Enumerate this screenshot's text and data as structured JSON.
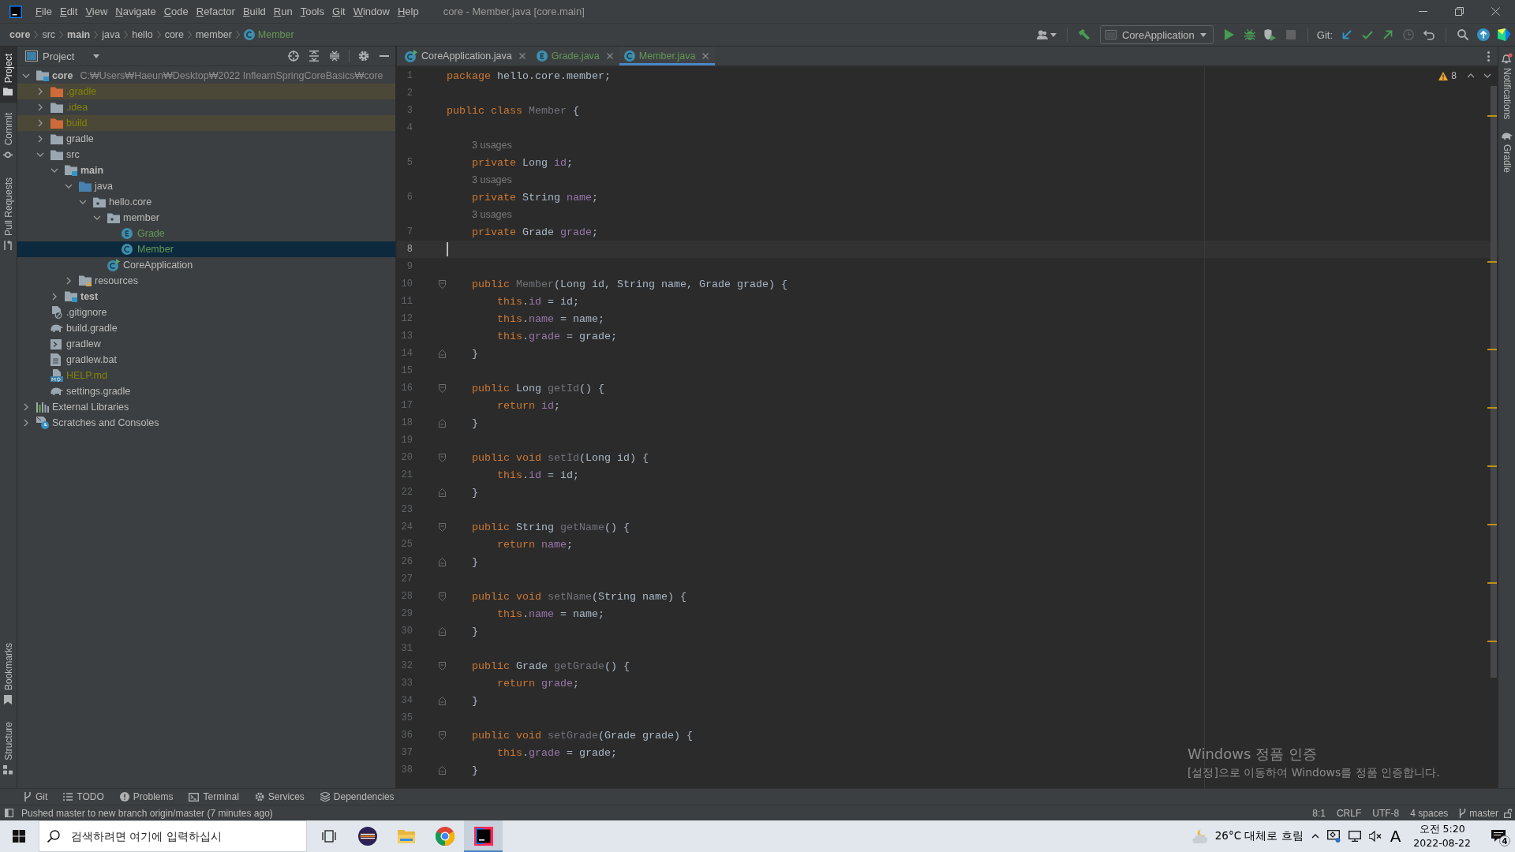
{
  "window": {
    "title": "core - Member.java [core.main]",
    "menu": [
      "File",
      "Edit",
      "View",
      "Navigate",
      "Code",
      "Refactor",
      "Build",
      "Run",
      "Tools",
      "Git",
      "Window",
      "Help"
    ]
  },
  "navigation_bar": {
    "breadcrumbs": [
      {
        "label": "core",
        "kind": "module",
        "added": false
      },
      {
        "label": "src",
        "kind": "folder",
        "added": false
      },
      {
        "label": "main",
        "kind": "sourceroot",
        "added": false
      },
      {
        "label": "java",
        "kind": "folder",
        "added": false
      },
      {
        "label": "hello",
        "kind": "folder",
        "added": false
      },
      {
        "label": "core",
        "kind": "folder",
        "added": false
      },
      {
        "label": "member",
        "kind": "folder",
        "added": false
      },
      {
        "label": "Member",
        "kind": "class",
        "added": true
      }
    ],
    "run_configuration": "CoreApplication",
    "git_label": "Git:"
  },
  "left_strip": {
    "top": [
      {
        "label": "Project",
        "kind": "project",
        "selected": true
      },
      {
        "label": "Commit",
        "kind": "commit",
        "selected": false
      },
      {
        "label": "Pull Requests",
        "kind": "pullrequests",
        "selected": false
      }
    ],
    "bottom": [
      {
        "label": "Bookmarks",
        "kind": "bookmarks",
        "selected": false
      },
      {
        "label": "Structure",
        "kind": "structure",
        "selected": false
      }
    ]
  },
  "project_panel": {
    "title": "Project",
    "tree": [
      {
        "label": "core",
        "path": "C:₩Users₩Haeun₩Desktop₩2022 InflearnSpringCoreBasics₩core",
        "kind": "module",
        "added": false,
        "ignored": false,
        "selected": false,
        "expanded": true,
        "children": [
          {
            "label": ".gradle",
            "kind": "excluded",
            "added": false,
            "ignored": true,
            "selected": false,
            "expanded": false
          },
          {
            "label": ".idea",
            "kind": "folder",
            "added": false,
            "ignored": true,
            "selected": false,
            "expanded": false
          },
          {
            "label": "build",
            "kind": "excluded",
            "added": false,
            "ignored": true,
            "selected": false,
            "expanded": false
          },
          {
            "label": "gradle",
            "kind": "folder",
            "added": false,
            "ignored": false,
            "selected": false,
            "expanded": false
          },
          {
            "label": "src",
            "kind": "folder",
            "added": false,
            "ignored": false,
            "selected": false,
            "expanded": true,
            "children": [
              {
                "label": "main",
                "kind": "sourceroot",
                "added": false,
                "ignored": false,
                "selected": false,
                "expanded": true,
                "children": [
                  {
                    "label": "java",
                    "kind": "javaroot",
                    "added": false,
                    "ignored": false,
                    "selected": false,
                    "expanded": true,
                    "children": [
                      {
                        "label": "hello.core",
                        "kind": "package",
                        "added": false,
                        "ignored": false,
                        "selected": false,
                        "expanded": true,
                        "children": [
                          {
                            "label": "member",
                            "kind": "package",
                            "added": false,
                            "ignored": false,
                            "selected": false,
                            "expanded": true,
                            "children": [
                              {
                                "label": "Grade",
                                "kind": "enum",
                                "added": true,
                                "ignored": false,
                                "selected": false
                              },
                              {
                                "label": "Member",
                                "kind": "class",
                                "added": true,
                                "ignored": false,
                                "selected": true
                              }
                            ]
                          },
                          {
                            "label": "CoreApplication",
                            "kind": "mainclass",
                            "added": false,
                            "ignored": false,
                            "selected": false
                          }
                        ]
                      }
                    ]
                  },
                  {
                    "label": "resources",
                    "kind": "resources",
                    "added": false,
                    "ignored": false,
                    "selected": false,
                    "expanded": false
                  }
                ]
              },
              {
                "label": "test",
                "kind": "sourceroot",
                "added": false,
                "ignored": false,
                "selected": false,
                "expanded": false
              }
            ]
          },
          {
            "label": ".gitignore",
            "kind": "ignorefile",
            "added": false,
            "ignored": false,
            "selected": false
          },
          {
            "label": "build.gradle",
            "kind": "gradle",
            "added": false,
            "ignored": false,
            "selected": false
          },
          {
            "label": "gradlew",
            "kind": "script",
            "added": false,
            "ignored": false,
            "selected": false
          },
          {
            "label": "gradlew.bat",
            "kind": "batch",
            "added": false,
            "ignored": false,
            "selected": false
          },
          {
            "label": "HELP.md",
            "kind": "markdown",
            "added": false,
            "ignored": true,
            "selected": false
          },
          {
            "label": "settings.gradle",
            "kind": "gradle",
            "added": false,
            "ignored": false,
            "selected": false
          }
        ]
      },
      {
        "label": "External Libraries",
        "kind": "libraries",
        "added": false,
        "ignored": false,
        "selected": false,
        "expanded": false
      },
      {
        "label": "Scratches and Consoles",
        "kind": "scratches",
        "added": false,
        "ignored": false,
        "selected": false,
        "expanded": false
      }
    ]
  },
  "editor": {
    "tabs": [
      {
        "label": "CoreApplication.java",
        "kind": "mainclass",
        "added": false,
        "selected": false
      },
      {
        "label": "Grade.java",
        "kind": "enum",
        "added": true,
        "selected": false
      },
      {
        "label": "Member.java",
        "kind": "class",
        "added": true,
        "selected": true
      }
    ],
    "warnings": "8",
    "lines": [
      {
        "kind": "code",
        "number": "1",
        "current": false,
        "tokens": [
          {
            "kind": "keyword",
            "text": "package "
          },
          {
            "kind": "plain",
            "text": "hello.core.member;"
          }
        ]
      },
      {
        "kind": "code",
        "number": "2",
        "current": false
      },
      {
        "kind": "code",
        "number": "3",
        "current": false,
        "tokens": [
          {
            "kind": "keyword",
            "text": "public class "
          },
          {
            "kind": "unused",
            "text": "Member"
          },
          {
            "kind": "plain",
            "text": " {"
          }
        ]
      },
      {
        "kind": "code",
        "number": "4",
        "current": false
      },
      {
        "kind": "inlay",
        "text": "3 usages"
      },
      {
        "kind": "code",
        "number": "5",
        "current": false,
        "tokens": [
          {
            "kind": "keyword",
            "text": "    private "
          },
          {
            "kind": "plain",
            "text": "Long "
          },
          {
            "kind": "field",
            "text": "id"
          },
          {
            "kind": "plain",
            "text": ";"
          }
        ]
      },
      {
        "kind": "inlay",
        "text": "3 usages"
      },
      {
        "kind": "code",
        "number": "6",
        "current": false,
        "tokens": [
          {
            "kind": "keyword",
            "text": "    private "
          },
          {
            "kind": "plain",
            "text": "String "
          },
          {
            "kind": "field",
            "text": "name"
          },
          {
            "kind": "plain",
            "text": ";"
          }
        ]
      },
      {
        "kind": "inlay",
        "text": "3 usages"
      },
      {
        "kind": "code",
        "number": "7",
        "current": false,
        "tokens": [
          {
            "kind": "keyword",
            "text": "    private "
          },
          {
            "kind": "plain",
            "text": "Grade "
          },
          {
            "kind": "field",
            "text": "grade"
          },
          {
            "kind": "plain",
            "text": ";"
          }
        ]
      },
      {
        "kind": "code",
        "number": "8",
        "current": true
      },
      {
        "kind": "code",
        "number": "9",
        "current": false
      },
      {
        "kind": "opener",
        "number": "10",
        "current": false,
        "tokens": [
          {
            "kind": "keyword",
            "text": "    public "
          },
          {
            "kind": "unused",
            "text": "Member"
          },
          {
            "kind": "plain",
            "text": "(Long id, String name, Grade grade) {"
          }
        ]
      },
      {
        "kind": "code",
        "number": "11",
        "current": false,
        "tokens": [
          {
            "kind": "keyword",
            "text": "        this"
          },
          {
            "kind": "plain",
            "text": "."
          },
          {
            "kind": "field",
            "text": "id"
          },
          {
            "kind": "plain",
            "text": " = id;"
          }
        ]
      },
      {
        "kind": "code",
        "number": "12",
        "current": false,
        "tokens": [
          {
            "kind": "keyword",
            "text": "        this"
          },
          {
            "kind": "plain",
            "text": "."
          },
          {
            "kind": "field",
            "text": "name"
          },
          {
            "kind": "plain",
            "text": " = name;"
          }
        ]
      },
      {
        "kind": "code",
        "number": "13",
        "current": false,
        "tokens": [
          {
            "kind": "keyword",
            "text": "        this"
          },
          {
            "kind": "plain",
            "text": "."
          },
          {
            "kind": "field",
            "text": "grade"
          },
          {
            "kind": "plain",
            "text": " = grade;"
          }
        ]
      },
      {
        "kind": "closer",
        "number": "14",
        "current": false,
        "tokens": [
          {
            "kind": "plain",
            "text": "    }"
          }
        ]
      },
      {
        "kind": "code",
        "number": "15",
        "current": false
      },
      {
        "kind": "opener",
        "number": "16",
        "current": false,
        "tokens": [
          {
            "kind": "keyword",
            "text": "    public "
          },
          {
            "kind": "plain",
            "text": "Long "
          },
          {
            "kind": "unused",
            "text": "getId"
          },
          {
            "kind": "plain",
            "text": "() {"
          }
        ]
      },
      {
        "kind": "code",
        "number": "17",
        "current": false,
        "tokens": [
          {
            "kind": "keyword",
            "text": "        return "
          },
          {
            "kind": "field",
            "text": "id"
          },
          {
            "kind": "plain",
            "text": ";"
          }
        ]
      },
      {
        "kind": "closer",
        "number": "18",
        "current": false,
        "tokens": [
          {
            "kind": "plain",
            "text": "    }"
          }
        ]
      },
      {
        "kind": "code",
        "number": "19",
        "current": false
      },
      {
        "kind": "opener",
        "number": "20",
        "current": false,
        "tokens": [
          {
            "kind": "keyword",
            "text": "    public void "
          },
          {
            "kind": "unused",
            "text": "setId"
          },
          {
            "kind": "plain",
            "text": "(Long id) {"
          }
        ]
      },
      {
        "kind": "code",
        "number": "21",
        "current": false,
        "tokens": [
          {
            "kind": "keyword",
            "text": "        this"
          },
          {
            "kind": "plain",
            "text": "."
          },
          {
            "kind": "field",
            "text": "id"
          },
          {
            "kind": "plain",
            "text": " = id;"
          }
        ]
      },
      {
        "kind": "closer",
        "number": "22",
        "current": false,
        "tokens": [
          {
            "kind": "plain",
            "text": "    }"
          }
        ]
      },
      {
        "kind": "code",
        "number": "23",
        "current": false
      },
      {
        "kind": "opener",
        "number": "24",
        "current": false,
        "tokens": [
          {
            "kind": "keyword",
            "text": "    public "
          },
          {
            "kind": "plain",
            "text": "String "
          },
          {
            "kind": "unused",
            "text": "getName"
          },
          {
            "kind": "plain",
            "text": "() {"
          }
        ]
      },
      {
        "kind": "code",
        "number": "25",
        "current": false,
        "tokens": [
          {
            "kind": "keyword",
            "text": "        return "
          },
          {
            "kind": "field",
            "text": "name"
          },
          {
            "kind": "plain",
            "text": ";"
          }
        ]
      },
      {
        "kind": "closer",
        "number": "26",
        "current": false,
        "tokens": [
          {
            "kind": "plain",
            "text": "    }"
          }
        ]
      },
      {
        "kind": "code",
        "number": "27",
        "current": false
      },
      {
        "kind": "opener",
        "number": "28",
        "current": false,
        "tokens": [
          {
            "kind": "keyword",
            "text": "    public void "
          },
          {
            "kind": "unused",
            "text": "setName"
          },
          {
            "kind": "plain",
            "text": "(String name) {"
          }
        ]
      },
      {
        "kind": "code",
        "number": "29",
        "current": false,
        "tokens": [
          {
            "kind": "keyword",
            "text": "        this"
          },
          {
            "kind": "plain",
            "text": "."
          },
          {
            "kind": "field",
            "text": "name"
          },
          {
            "kind": "plain",
            "text": " = name;"
          }
        ]
      },
      {
        "kind": "closer",
        "number": "30",
        "current": false,
        "tokens": [
          {
            "kind": "plain",
            "text": "    }"
          }
        ]
      },
      {
        "kind": "code",
        "number": "31",
        "current": false
      },
      {
        "kind": "opener",
        "number": "32",
        "current": false,
        "tokens": [
          {
            "kind": "keyword",
            "text": "    public "
          },
          {
            "kind": "plain",
            "text": "Grade "
          },
          {
            "kind": "unused",
            "text": "getGrade"
          },
          {
            "kind": "plain",
            "text": "() {"
          }
        ]
      },
      {
        "kind": "code",
        "number": "33",
        "current": false,
        "tokens": [
          {
            "kind": "keyword",
            "text": "        return "
          },
          {
            "kind": "field",
            "text": "grade"
          },
          {
            "kind": "plain",
            "text": ";"
          }
        ]
      },
      {
        "kind": "closer",
        "number": "34",
        "current": false,
        "tokens": [
          {
            "kind": "plain",
            "text": "    }"
          }
        ]
      },
      {
        "kind": "code",
        "number": "35",
        "current": false
      },
      {
        "kind": "opener",
        "number": "36",
        "current": false,
        "tokens": [
          {
            "kind": "keyword",
            "text": "    public void "
          },
          {
            "kind": "unused",
            "text": "setGrade"
          },
          {
            "kind": "plain",
            "text": "(Grade grade) {"
          }
        ]
      },
      {
        "kind": "code",
        "number": "37",
        "current": false,
        "tokens": [
          {
            "kind": "keyword",
            "text": "        this"
          },
          {
            "kind": "plain",
            "text": "."
          },
          {
            "kind": "field",
            "text": "grade"
          },
          {
            "kind": "plain",
            "text": " = grade;"
          }
        ]
      },
      {
        "kind": "closer",
        "number": "38",
        "current": false,
        "tokens": [
          {
            "kind": "plain",
            "text": "    }"
          }
        ]
      }
    ]
  },
  "right_strip": [
    {
      "label": "Notifications",
      "kind": "notifications"
    },
    {
      "label": "Gradle",
      "kind": "gradle"
    }
  ],
  "tool_window_bar": [
    {
      "label": "Git",
      "kind": "git"
    },
    {
      "label": "TODO",
      "kind": "todo"
    },
    {
      "label": "Problems",
      "kind": "problems"
    },
    {
      "label": "Terminal",
      "kind": "terminal"
    },
    {
      "label": "Services",
      "kind": "services"
    },
    {
      "label": "Dependencies",
      "kind": "dependencies"
    }
  ],
  "status_bar": {
    "message": "Pushed master to new branch origin/master (7 minutes ago)",
    "caret": "8:1",
    "line_separator": "CRLF",
    "encoding": "UTF-8",
    "indent": "4 spaces",
    "branch": "master"
  },
  "taskbar": {
    "search": {
      "placeholder": "검색하려면 여기에 입력하십시"
    },
    "apps": [
      {
        "kind": "taskview",
        "selected": false
      },
      {
        "kind": "eclipse",
        "selected": false
      },
      {
        "kind": "explorer",
        "selected": false
      },
      {
        "kind": "chrome",
        "selected": false
      },
      {
        "kind": "intellij",
        "selected": true
      }
    ],
    "weather": "26°C 대체로 흐림",
    "input_mode": "A",
    "time": "오전 5:20",
    "date": "2022-08-22",
    "notification_count": "4"
  },
  "activation_notice": {
    "title": "Windows 정품 인증",
    "message": "[설정]으로 이동하여 Windows를 정품 인증합니다."
  }
}
